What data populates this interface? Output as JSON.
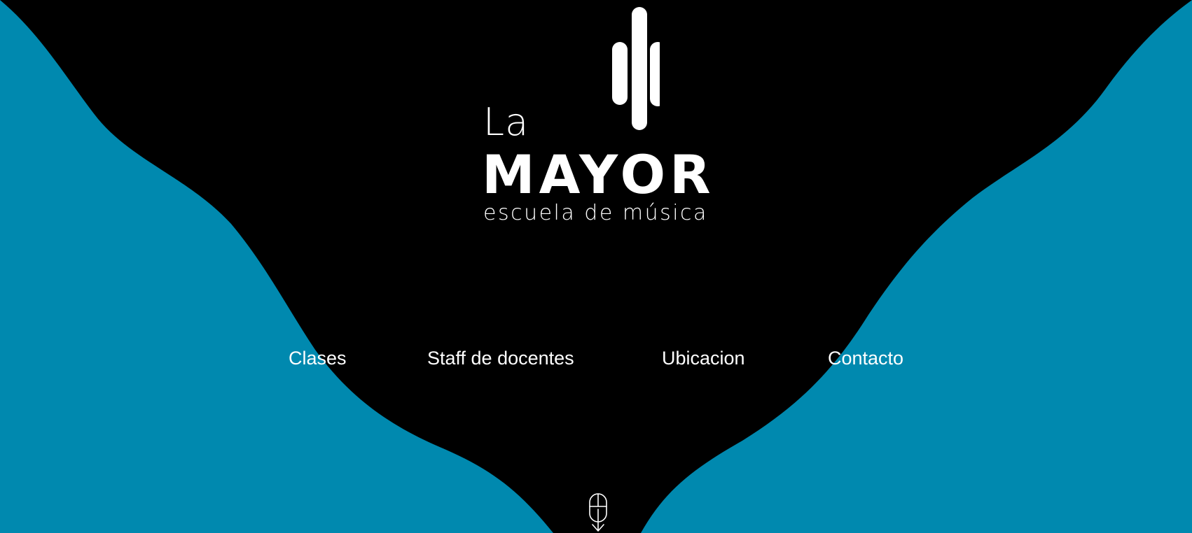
{
  "logo": {
    "la": "La",
    "mayor": "MAYOR",
    "subtitle": "escuela de música"
  },
  "nav": {
    "items": [
      {
        "label": "Clases"
      },
      {
        "label": "Staff de docentes"
      },
      {
        "label": "Ubicacion"
      },
      {
        "label": "Contacto"
      }
    ]
  },
  "scroll_icon": "mouse-scroll-down-icon",
  "colors": {
    "background_side": "#0089af",
    "center_shape": "#000000",
    "text": "#ffffff"
  }
}
